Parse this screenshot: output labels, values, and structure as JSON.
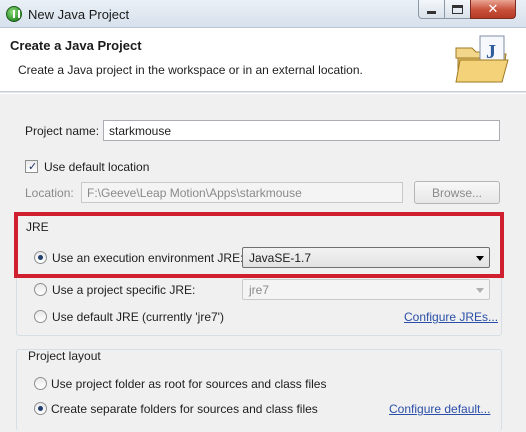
{
  "window": {
    "title": "New Java Project"
  },
  "header": {
    "title": "Create a Java Project",
    "description": "Create a Java project in the workspace or in an external location."
  },
  "project": {
    "name_label": "Project name:",
    "name_value": "starkmouse",
    "use_default_location_label": "Use default location",
    "use_default_location_checked": true,
    "location_label": "Location:",
    "location_value": "F:\\Geeve\\Leap Motion\\Apps\\starkmouse",
    "browse_label": "Browse..."
  },
  "jre": {
    "group_title": "JRE",
    "options": [
      {
        "label": "Use an execution environment JRE:",
        "selected": true
      },
      {
        "label": "Use a project specific JRE:",
        "selected": false
      },
      {
        "label": "Use default JRE (currently 'jre7')",
        "selected": false
      }
    ],
    "execution_env_value": "JavaSE-1.7",
    "project_jre_value": "jre7",
    "configure_link": "Configure JREs..."
  },
  "layout": {
    "group_title": "Project layout",
    "options": [
      {
        "label": "Use project folder as root for sources and class files",
        "selected": false
      },
      {
        "label": "Create separate folders for sources and class files",
        "selected": true
      }
    ],
    "configure_link": "Configure default..."
  },
  "colors": {
    "highlight": "#d0202f",
    "link": "#2a4fa8"
  }
}
